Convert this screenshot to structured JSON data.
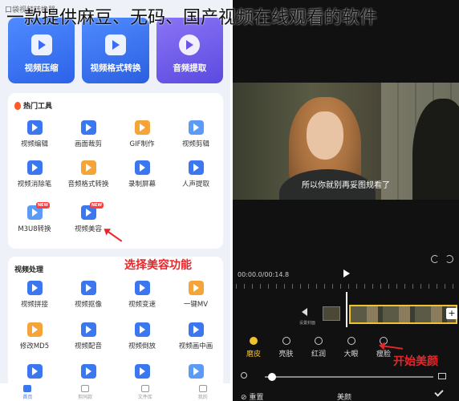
{
  "overlay_title": "一款提供麻豆、无码、国产视频在线观看的软件",
  "status_text": "口袋视频转换器",
  "top_cards": [
    {
      "label": "视频压缩",
      "icon": "compress-icon"
    },
    {
      "label": "视频格式转换",
      "icon": "convert-icon"
    },
    {
      "label": "音频提取",
      "icon": "audio-extract-icon"
    }
  ],
  "hot_tools": {
    "title": "热门工具",
    "items": [
      {
        "label": "视频编辑",
        "icon": "video-edit-icon"
      },
      {
        "label": "画面裁剪",
        "icon": "crop-icon"
      },
      {
        "label": "GIF制作",
        "icon": "gif-icon"
      },
      {
        "label": "视频剪辑",
        "icon": "video-cut-icon"
      },
      {
        "label": "视频消除笔",
        "icon": "eraser-icon"
      },
      {
        "label": "音频格式转换",
        "icon": "audio-convert-icon"
      },
      {
        "label": "录制屏幕",
        "icon": "screen-record-icon"
      },
      {
        "label": "人声提取",
        "icon": "voice-extract-icon"
      },
      {
        "label": "M3U8转换",
        "icon": "m3u8-icon",
        "badge": "NEW"
      },
      {
        "label": "视频美容",
        "icon": "beauty-icon",
        "badge": "NEW"
      }
    ]
  },
  "video_processing": {
    "title": "视频处理",
    "items": [
      {
        "label": "视频拼接",
        "icon": "merge-icon"
      },
      {
        "label": "视频抠像",
        "icon": "cutout-icon"
      },
      {
        "label": "视频变速",
        "icon": "speed-icon"
      },
      {
        "label": "一键MV",
        "icon": "mv-icon"
      },
      {
        "label": "修改MD5",
        "icon": "md5-icon"
      },
      {
        "label": "视频配音",
        "icon": "dubbing-icon"
      },
      {
        "label": "视频倒放",
        "icon": "reverse-icon"
      },
      {
        "label": "视频画中画",
        "icon": "pip-icon"
      }
    ]
  },
  "annotations": {
    "left": "选择美容功能",
    "right": "开始美颜"
  },
  "bottom_nav": [
    {
      "label": "首页",
      "active": true
    },
    {
      "label": "剪同款",
      "active": false
    },
    {
      "label": "文件库",
      "active": false
    },
    {
      "label": "我的",
      "active": false
    }
  ],
  "player": {
    "subtitle": "所以你就别再妥图规看了",
    "time": "00:00.0/00:14.8",
    "cover_label": "设置封面"
  },
  "beauty_tools": [
    {
      "label": "磨皮",
      "active": true
    },
    {
      "label": "亮肤",
      "active": false
    },
    {
      "label": "红润",
      "active": false
    },
    {
      "label": "大眼",
      "active": false
    },
    {
      "label": "瘦脸",
      "active": false
    }
  ],
  "bottom_bar": {
    "reset": "重置",
    "panel_name": "美颜"
  },
  "colors": {
    "accent_blue": "#3b78f0",
    "annotation_red": "#e8262a",
    "active_yellow": "#f2c12e"
  }
}
